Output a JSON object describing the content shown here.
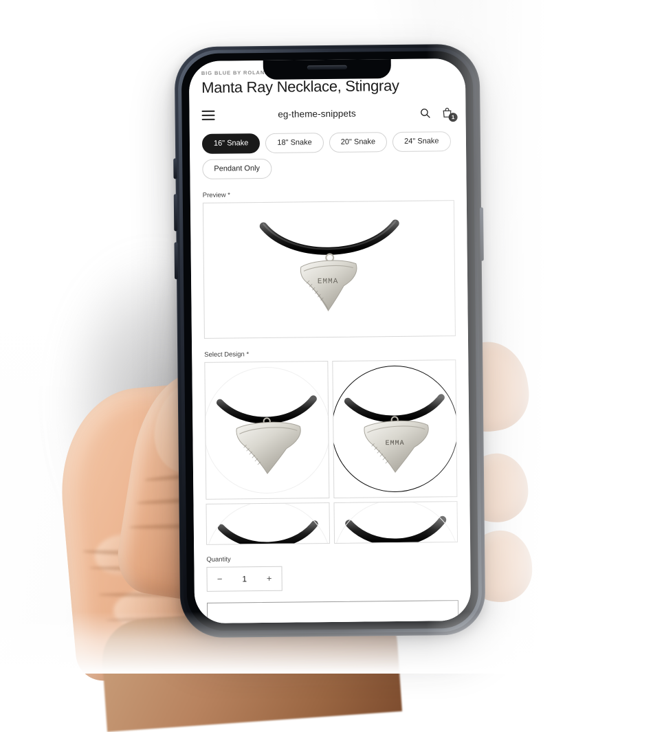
{
  "device": {
    "kind": "smartphone-in-hand-mockup",
    "notch": true,
    "buttons": [
      "mute-switch",
      "volume-up",
      "volume-down",
      "power"
    ]
  },
  "product_header": {
    "vendor": "BIG BLUE BY ROLAND ST JOHN",
    "title": "Manta Ray Necklace, Stingray"
  },
  "topbar": {
    "menu_icon": "hamburger-icon",
    "shop_name": "eg-theme-snippets",
    "search_icon": "search-icon",
    "cart_icon": "shopping-bag-icon",
    "cart_count": "1"
  },
  "variants": {
    "options": [
      {
        "label": "16\" Snake",
        "selected": true
      },
      {
        "label": "18\" Snake",
        "selected": false
      },
      {
        "label": "20\" Snake",
        "selected": false
      },
      {
        "label": "24\" Snake",
        "selected": false
      },
      {
        "label": "Pendant Only",
        "selected": false
      }
    ]
  },
  "preview": {
    "label": "Preview *",
    "engraving": "EMMA",
    "alt": "shark tooth pendant engraved EMMA on black braided cord"
  },
  "select_design": {
    "label": "Select Design *",
    "options": [
      {
        "id": "design-plain",
        "engraving": "",
        "selected": false
      },
      {
        "id": "design-emma",
        "engraving": "EMMA",
        "selected": true
      },
      {
        "id": "design-3",
        "engraving": "",
        "selected": false
      },
      {
        "id": "design-4",
        "engraving": "",
        "selected": false
      }
    ]
  },
  "quantity": {
    "label": "Quantity",
    "decrement": "−",
    "value": "1",
    "increment": "+"
  },
  "add_to_cart": {
    "label": ""
  },
  "colors": {
    "accent": "#1a1a1a",
    "border": "#d8d8d8",
    "pill_border": "#d2d2d2",
    "text": "#1a1a1a",
    "muted": "#8c8c8c",
    "page_bg": "#ffffff",
    "device_frame": "#12161d"
  }
}
